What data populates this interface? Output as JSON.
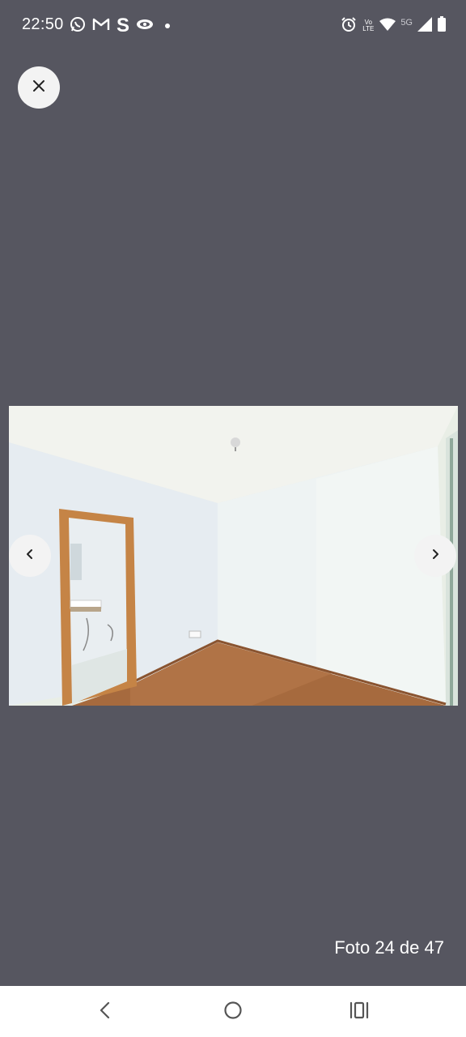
{
  "status_bar": {
    "time": "22:50",
    "left_icons": [
      "whatsapp-icon",
      "gmail-icon",
      "s-app-icon",
      "eye-app-icon",
      "notification-dot"
    ],
    "right_icons": [
      "alarm-icon",
      "volte-icon",
      "wifi-icon",
      "5g-icon",
      "signal-icon",
      "battery-icon"
    ],
    "network_label": "5G",
    "volte_label": "Vo LTE",
    "s_label": "S"
  },
  "viewer": {
    "background_color": "#565660",
    "counter_text": "Foto 24 de 47",
    "photo_description_icon": "room-photo"
  },
  "controls": {
    "close_icon": "close-icon",
    "prev_icon": "chevron-left-icon",
    "next_icon": "chevron-right-icon"
  },
  "system_nav": {
    "back_icon": "back-icon",
    "home_icon": "home-icon",
    "recents_icon": "recents-icon"
  }
}
